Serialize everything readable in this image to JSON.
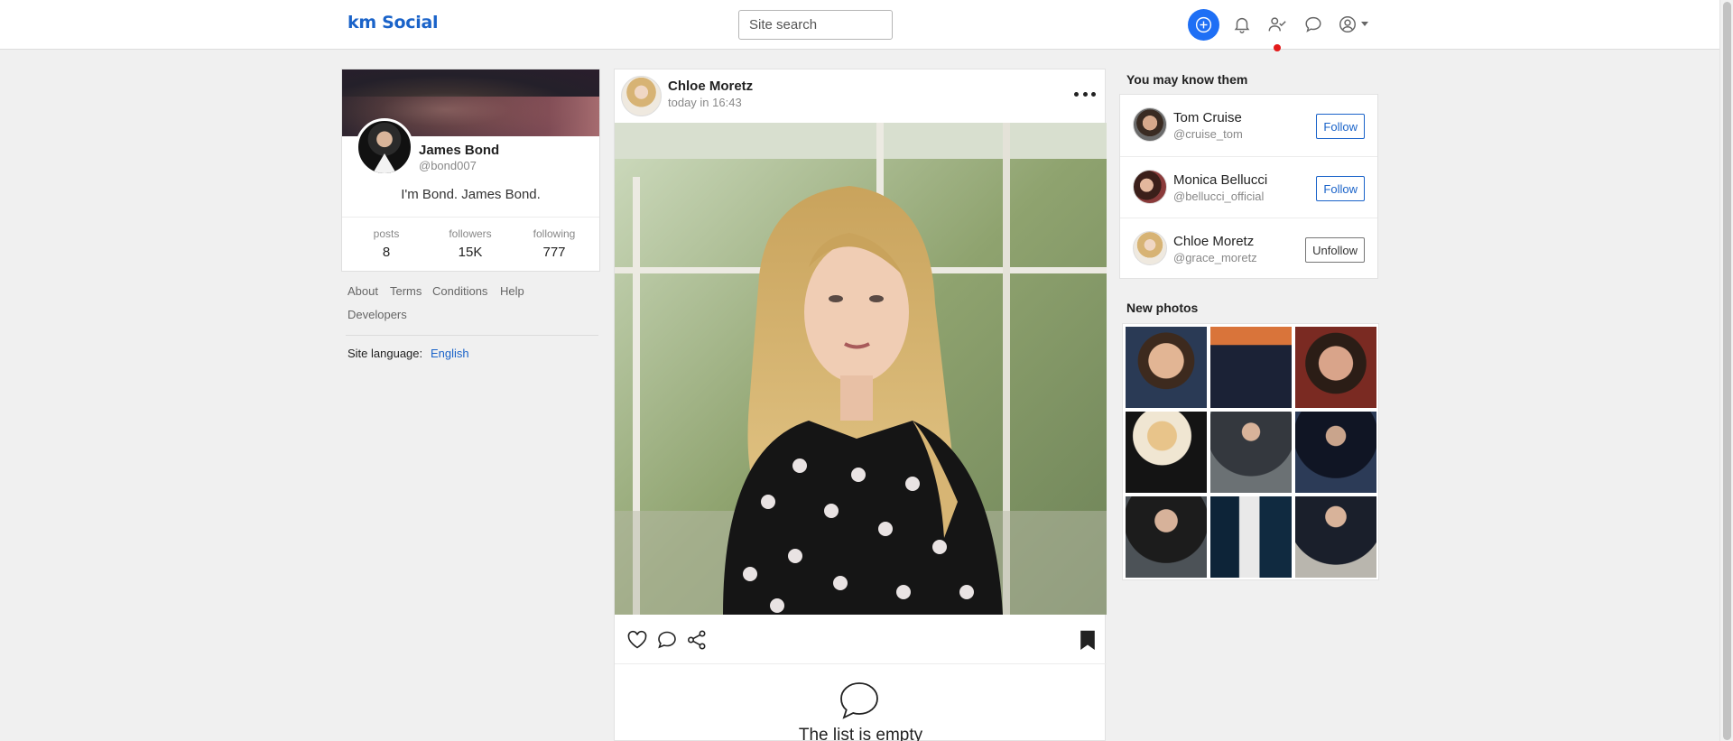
{
  "header": {
    "logo": "km Social",
    "search_placeholder": "Site search",
    "icons": [
      "add-circle-icon",
      "bell-icon",
      "user-check-icon",
      "chat-icon",
      "user-circle-icon",
      "caret-down-icon"
    ],
    "accent": "#1e6ff5",
    "notification_color": "#e31b1b"
  },
  "profile": {
    "name": "James Bond",
    "handle": "@bond007",
    "bio": "I'm Bond. James Bond.",
    "stats": [
      {
        "label": "posts",
        "value": "8"
      },
      {
        "label": "followers",
        "value": "15K"
      },
      {
        "label": "following",
        "value": "777"
      }
    ]
  },
  "footer": {
    "links": [
      "About",
      "Terms",
      "Conditions",
      "Help",
      "Developers"
    ],
    "language_label": "Site language:",
    "language_value": "English"
  },
  "post": {
    "author": "Chloe Moretz",
    "time": "today in 16:43",
    "actions": [
      "heart-icon",
      "comment-icon",
      "share-icon",
      "bookmark-icon"
    ],
    "empty_text": "The list is empty"
  },
  "suggestions": {
    "title": "You may know them",
    "people": [
      {
        "name": "Tom Cruise",
        "handle": "@cruise_tom",
        "button": "Follow"
      },
      {
        "name": "Monica Bellucci",
        "handle": "@bellucci_official",
        "button": "Follow"
      },
      {
        "name": "Chloe Moretz",
        "handle": "@grace_moretz",
        "button": "Unfollow"
      }
    ]
  },
  "new_photos": {
    "title": "New photos",
    "count": 9
  }
}
